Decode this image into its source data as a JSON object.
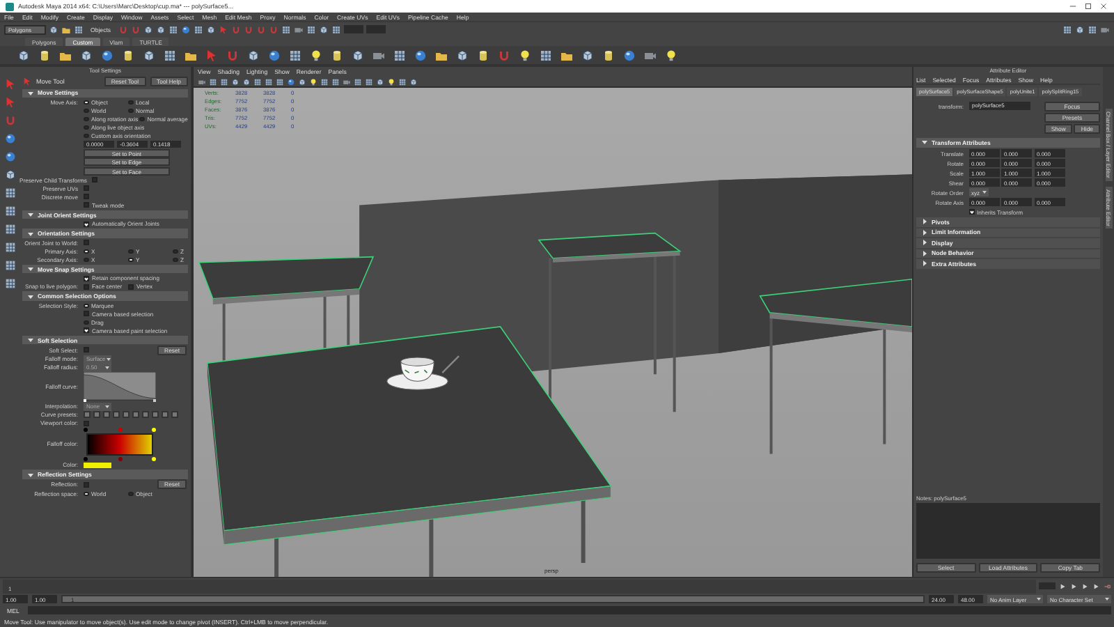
{
  "window": {
    "title": "Autodesk Maya 2014 x64: C:\\Users\\Marc\\Desktop\\cup.ma*   ---   polySurface5..."
  },
  "menu_bar": [
    "File",
    "Edit",
    "Modify",
    "Create",
    "Display",
    "Window",
    "Assets",
    "Select",
    "Mesh",
    "Edit Mesh",
    "Proxy",
    "Normals",
    "Color",
    "Create UVs",
    "Edit UVs",
    "Pipeline Cache",
    "Help"
  ],
  "status_line": {
    "mode": "Polygons",
    "selection": "Objects"
  },
  "shelf": {
    "tabs": [
      {
        "label": "Polygons",
        "selected": false
      },
      {
        "label": "Custom",
        "selected": true
      },
      {
        "label": "Vlam",
        "selected": false
      },
      {
        "label": "TURTLE",
        "selected": false
      }
    ]
  },
  "tool_settings": {
    "title": "Tool Settings",
    "tool": "Move Tool",
    "buttons": [
      "Reset Tool",
      "Tool Help"
    ],
    "sections": [
      {
        "title": "Move Settings",
        "rows": [
          {
            "kind": "radio",
            "label": "Move Axis:",
            "options": [
              {
                "label": "Object",
                "selected": true
              },
              {
                "label": "Local",
                "selected": false
              }
            ]
          },
          {
            "kind": "radio",
            "options": [
              {
                "label": "World",
                "selected": false
              },
              {
                "label": "Normal",
                "selected": false
              }
            ]
          },
          {
            "kind": "radio",
            "options": [
              {
                "label": "Along rotation axis",
                "selected": false
              },
              {
                "label": "Normal average",
                "selected": false
              }
            ]
          },
          {
            "kind": "radio",
            "options": [
              {
                "label": "Along live object axis",
                "selected": false
              }
            ]
          },
          {
            "kind": "radio",
            "options": [
              {
                "label": "Custom axis orientation",
                "selected": false
              }
            ]
          },
          {
            "kind": "fields",
            "values": [
              "0.0000",
              "-0.3604",
              "0.1418"
            ]
          },
          {
            "kind": "button",
            "label": "Set to Point"
          },
          {
            "kind": "button",
            "label": "Set to Edge"
          },
          {
            "kind": "button",
            "label": "Set to Face"
          },
          {
            "kind": "check",
            "label": "Preserve Child Transforms",
            "checked": false
          },
          {
            "kind": "check",
            "label": "Preserve UVs",
            "checked": false
          },
          {
            "kind": "check",
            "label": "Discrete move",
            "checked": false
          },
          {
            "kind": "toggle",
            "label": "Tweak mode",
            "checked": false
          }
        ]
      },
      {
        "title": "Joint Orient Settings",
        "rows": [
          {
            "kind": "toggle",
            "label": "Automatically Orient Joints",
            "checked": true
          }
        ]
      },
      {
        "title": "Orientation Settings",
        "rows": [
          {
            "kind": "check",
            "label": "Orient Joint to World:",
            "checked": false
          },
          {
            "kind": "radio",
            "label": "Primary Axis:",
            "options": [
              {
                "label": "X",
                "selected": true
              },
              {
                "label": "Y",
                "selected": false
              },
              {
                "label": "Z",
                "selected": false
              }
            ]
          },
          {
            "kind": "radio",
            "label": "Secondary Axis:",
            "options": [
              {
                "label": "X",
                "selected": false
              },
              {
                "label": "Y",
                "selected": true
              },
              {
                "label": "Z",
                "selected": false
              }
            ]
          }
        ]
      },
      {
        "title": "Move Snap Settings",
        "rows": [
          {
            "kind": "toggle",
            "label": "Retain component spacing",
            "checked": true
          },
          {
            "kind": "checks",
            "label": "Snap to live polygon:",
            "options": [
              {
                "label": "Face center",
                "checked": false
              },
              {
                "label": "Vertex",
                "checked": false
              }
            ]
          }
        ]
      },
      {
        "title": "Common Selection Options",
        "rows": [
          {
            "kind": "radio",
            "label": "Selection Style:",
            "options": [
              {
                "label": "Marquee",
                "selected": true
              }
            ]
          },
          {
            "kind": "toggle",
            "label": "Camera based selection",
            "checked": false
          },
          {
            "kind": "radio",
            "options": [
              {
                "label": "Drag",
                "selected": false
              }
            ]
          },
          {
            "kind": "toggle",
            "label": "Camera based paint selection",
            "checked": true
          }
        ]
      },
      {
        "title": "Soft Selection",
        "rows": [
          {
            "kind": "check",
            "label": "Soft Select:",
            "checked": false,
            "button": "Reset"
          },
          {
            "kind": "select",
            "label": "Falloff mode:",
            "value": "Surface"
          },
          {
            "kind": "select",
            "label": "Falloff radius:",
            "value": "0.50"
          },
          {
            "kind": "curve",
            "label": "Falloff curve:"
          },
          {
            "kind": "select",
            "label": "Interpolation:",
            "value": "None"
          },
          {
            "kind": "presets",
            "label": "Curve presets:"
          },
          {
            "kind": "check",
            "label": "Viewport color:",
            "checked": false
          },
          {
            "kind": "gradient",
            "label": "Falloff color:"
          },
          {
            "kind": "swatch",
            "label": "Color:",
            "color": "#f2ee00"
          }
        ]
      },
      {
        "title": "Reflection Settings",
        "rows": [
          {
            "kind": "check",
            "label": "Reflection:",
            "checked": false,
            "button": "Reset"
          },
          {
            "kind": "radio",
            "label": "Reflection space:",
            "options": [
              {
                "label": "World",
                "selected": true
              },
              {
                "label": "Object",
                "selected": false
              }
            ]
          }
        ]
      }
    ]
  },
  "viewport": {
    "menu": [
      "View",
      "Shading",
      "Lighting",
      "Show",
      "Renderer",
      "Panels"
    ],
    "stats": [
      {
        "label": "Verts:",
        "values": [
          "3828",
          "3828",
          "0"
        ]
      },
      {
        "label": "Edges:",
        "values": [
          "7752",
          "7752",
          "0"
        ]
      },
      {
        "label": "Faces:",
        "values": [
          "3876",
          "3876",
          "0"
        ]
      },
      {
        "label": "Tris:",
        "values": [
          "7752",
          "7752",
          "0"
        ]
      },
      {
        "label": "UVs:",
        "values": [
          "4429",
          "4429",
          "0"
        ]
      }
    ],
    "camera": "persp"
  },
  "attribute_editor": {
    "title": "Attribute Editor",
    "menu": [
      "List",
      "Selected",
      "Focus",
      "Attributes",
      "Show",
      "Help"
    ],
    "tabs": [
      {
        "label": "polySurface5",
        "selected": true
      },
      {
        "label": "polySurfaceShape5",
        "selected": false
      },
      {
        "label": "polyUnite1",
        "selected": false
      },
      {
        "label": "polySplitRing15",
        "selected": false
      }
    ],
    "node_label": "transform:",
    "node_name": "polySurface5",
    "buttons": [
      "Focus",
      "Presets"
    ],
    "show_hide": [
      "Show",
      "Hide"
    ],
    "section": "Transform Attributes",
    "rows": [
      {
        "label": "Translate",
        "values": [
          "0.000",
          "0.000",
          "0.000"
        ]
      },
      {
        "label": "Rotate",
        "values": [
          "0.000",
          "0.000",
          "0.000"
        ]
      },
      {
        "label": "Scale",
        "values": [
          "1.000",
          "1.000",
          "1.000"
        ]
      },
      {
        "label": "Shear",
        "values": [
          "0.000",
          "0.000",
          "0.000"
        ]
      }
    ],
    "rotate_order": {
      "label": "Rotate Order",
      "value": "xyz"
    },
    "rotate_axis": {
      "label": "Rotate Axis",
      "values": [
        "0.000",
        "0.000",
        "0.000"
      ]
    },
    "inherits": {
      "label": "Inherits Transform",
      "checked": true
    },
    "collapsed": [
      "Pivots",
      "Limit Information",
      "Display",
      "Node Behavior",
      "Extra Attributes"
    ],
    "notes": "Notes:  polySurface5",
    "footer": [
      "Select",
      "Load Attributes",
      "Copy Tab"
    ],
    "side_tabs": [
      "Channel Box / Layer Editor",
      "Attribute Editor"
    ]
  },
  "range": {
    "start": "1.00",
    "inner_start": "1.00",
    "slider": "1",
    "level": 1,
    "inner_end": "24.00",
    "end": "48.00",
    "anim_layer": "No Anim Layer",
    "character_set": "No Character Set"
  },
  "timeline": {
    "current": "1"
  },
  "command_line": {
    "label": "MEL"
  },
  "help_line": "Move Tool: Use manipulator to move object(s). Use edit mode to change pivot (INSERT). Ctrl+LMB to move perpendicular."
}
